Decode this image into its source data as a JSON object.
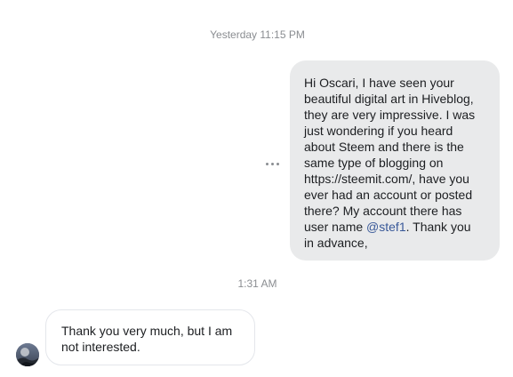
{
  "timestamps": {
    "first": "Yesterday 11:15 PM",
    "second": "1:31 AM"
  },
  "messages": {
    "outgoing": {
      "text_before": "Hi Oscari, I have seen your beautiful digital art in Hiveblog, they are very impressive. I was just wondering if you heard about Steem and there is the same type of blogging on https://steemit.com/, have you ever had an account or posted there? My account there has user name ",
      "mention": "@stef1",
      "text_after": ". Thank you in advance,"
    },
    "incoming": {
      "text": "Thank you very much, but I am not interested."
    }
  },
  "icons": {
    "more_options": "more-horizontal-icon",
    "avatar": "contact-avatar"
  },
  "colors": {
    "outgoing_bubble": "#e9eaeb",
    "incoming_border": "#e4e6eb",
    "mention": "#385898",
    "timestamp": "#8a8d91",
    "text": "#1c1e21"
  }
}
